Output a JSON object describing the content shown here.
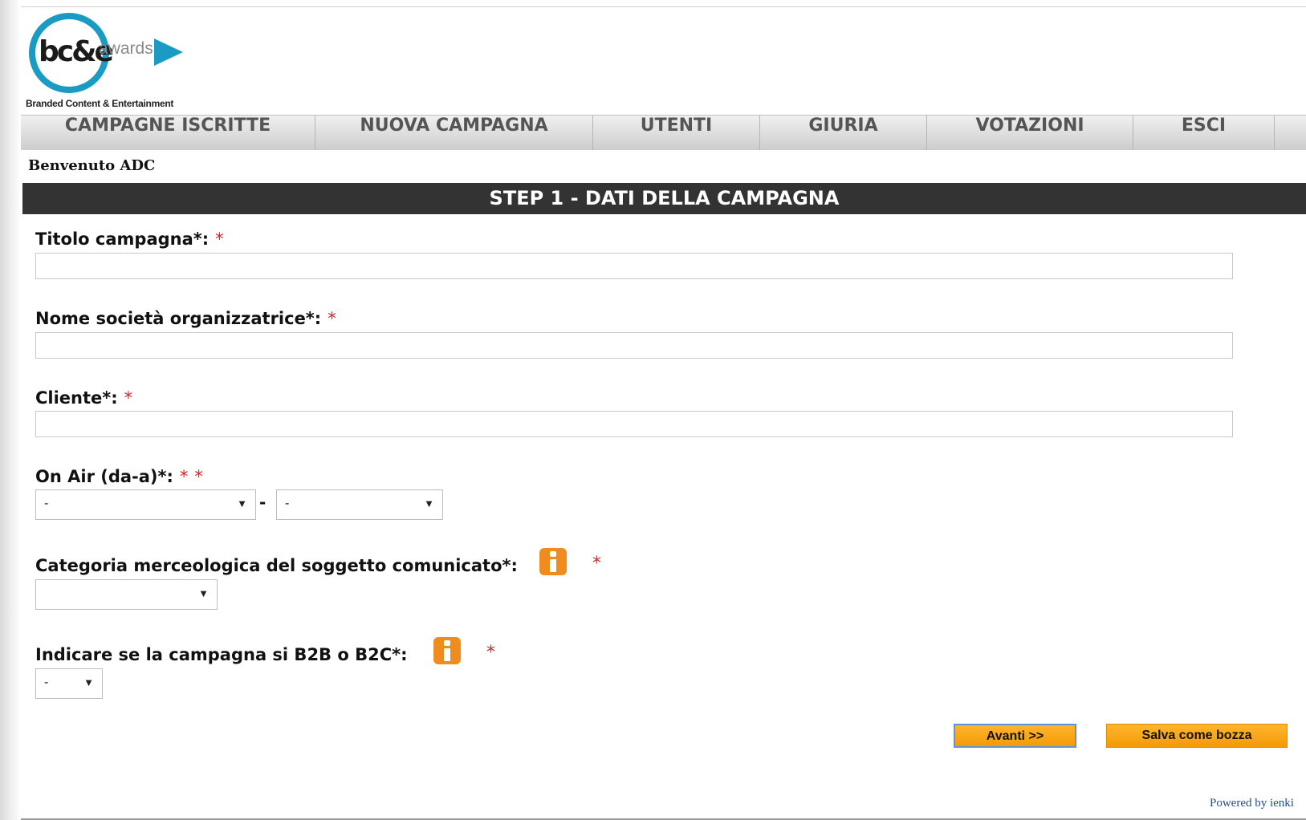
{
  "logo": {
    "mark": "bc&e",
    "awards": "awards",
    "tagline": "Branded Content & Entertainment"
  },
  "nav": {
    "items": [
      {
        "label": "CAMPAGNE ISCRITTE"
      },
      {
        "label": "NUOVA CAMPAGNA"
      },
      {
        "label": "UTENTI"
      },
      {
        "label": "GIURIA"
      },
      {
        "label": "VOTAZIONI"
      },
      {
        "label": "ESCI"
      }
    ]
  },
  "welcome": "Benvenuto ADC",
  "step_title": "STEP 1 - DATI DELLA CAMPAGNA",
  "form": {
    "title_label": "Titolo campagna*:",
    "title_value": "",
    "company_label": "Nome società organizzatrice*:",
    "company_value": "",
    "client_label": "Cliente*:",
    "client_value": "",
    "onair_label": "On Air (da-a)*:",
    "onair_from": "-",
    "onair_separator": "-",
    "onair_to": "-",
    "category_label": "Categoria merceologica del soggetto comunicato*:",
    "category_value": "",
    "b2b_label": "Indicare se la campagna si B2B o B2C*:",
    "b2b_value": "-",
    "required_mark": "*"
  },
  "buttons": {
    "next": "Avanti >>",
    "draft": "Salva come bozza"
  },
  "footer": {
    "powered": "Powered by ienki"
  },
  "colors": {
    "accent_blue": "#1a9bc4",
    "header_bar": "#333333",
    "button_orange": "#f39a06",
    "required_red": "#e02020",
    "info_orange": "#f08c1e"
  },
  "icons": [
    "info-icon",
    "dropdown-arrow-icon",
    "play-icon"
  ]
}
